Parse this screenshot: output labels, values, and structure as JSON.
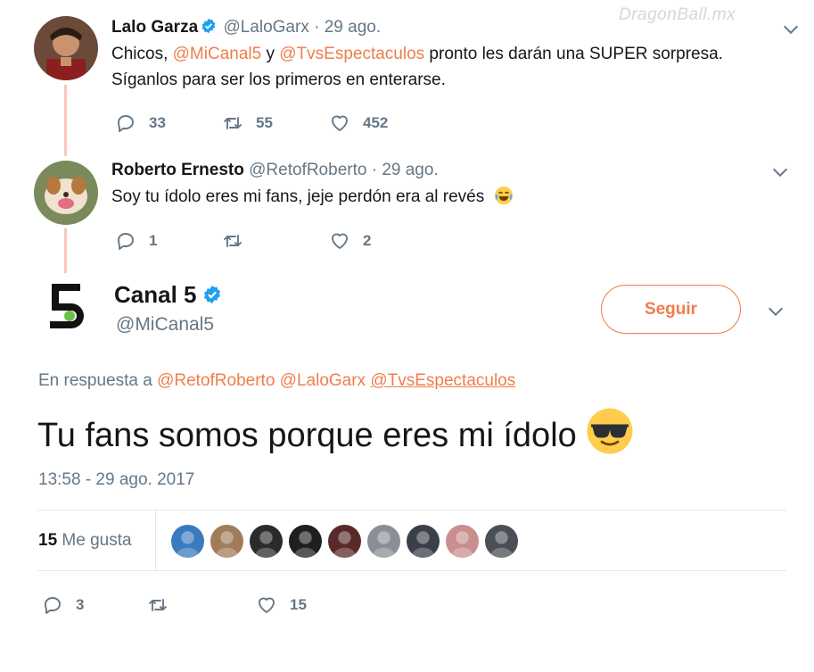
{
  "watermark": "DragonBall.mx",
  "colors": {
    "accent": "#f07d4a",
    "muted": "#657786",
    "verified": "#1da1f2",
    "thread_line": "#f7c9b8"
  },
  "tweet1": {
    "name": "Lalo Garza",
    "handle": "@LaloGarx",
    "date": "· 29 ago.",
    "text_1": "Chicos, ",
    "mention_1": "@MiCanal5",
    "text_2": " y ",
    "mention_2": "@TvsEspectaculos",
    "text_3": " pronto les darán una SUPER sorpresa.",
    "text_line2": "Síganlos para ser los primeros en enterarse.",
    "reply_count": "33",
    "retweet_count": "55",
    "like_count": "452"
  },
  "tweet2": {
    "name": "Roberto Ernesto",
    "handle": "@RetofRoberto",
    "date": "· 29 ago.",
    "text": "Soy tu ídolo eres mi fans, jeje perdón era al revés",
    "emoji": "tears-of-joy-emoji",
    "reply_count": "1",
    "retweet_count": "",
    "like_count": "2"
  },
  "main_tweet": {
    "name": "Canal 5",
    "handle": "@MiCanal5",
    "follow_label": "Seguir",
    "reply_prefix": "En respuesta a",
    "reply_mentions": [
      "@RetofRoberto",
      "@LaloGarx",
      "@TvsEspectaculos"
    ],
    "text": "Tu fans somos porque eres mi ídolo",
    "emoji": "sunglasses-emoji",
    "timestamp": "13:58 - 29 ago. 2017",
    "likes_number": "15",
    "likes_label": "Me gusta",
    "reply_count": "3",
    "retweet_count": "",
    "like_count": "15",
    "liker_colors": [
      "#3a7bbf",
      "#a07c5a",
      "#2b2b2b",
      "#1f1f1f",
      "#5a2a2a",
      "#8a8f96",
      "#3b3f4a",
      "#c98f8f",
      "#4a4f55"
    ]
  },
  "icons": {
    "reply": "reply-icon",
    "retweet": "retweet-icon",
    "like": "heart-icon",
    "menu": "chevron-down-icon",
    "verified": "verified-badge-icon"
  }
}
